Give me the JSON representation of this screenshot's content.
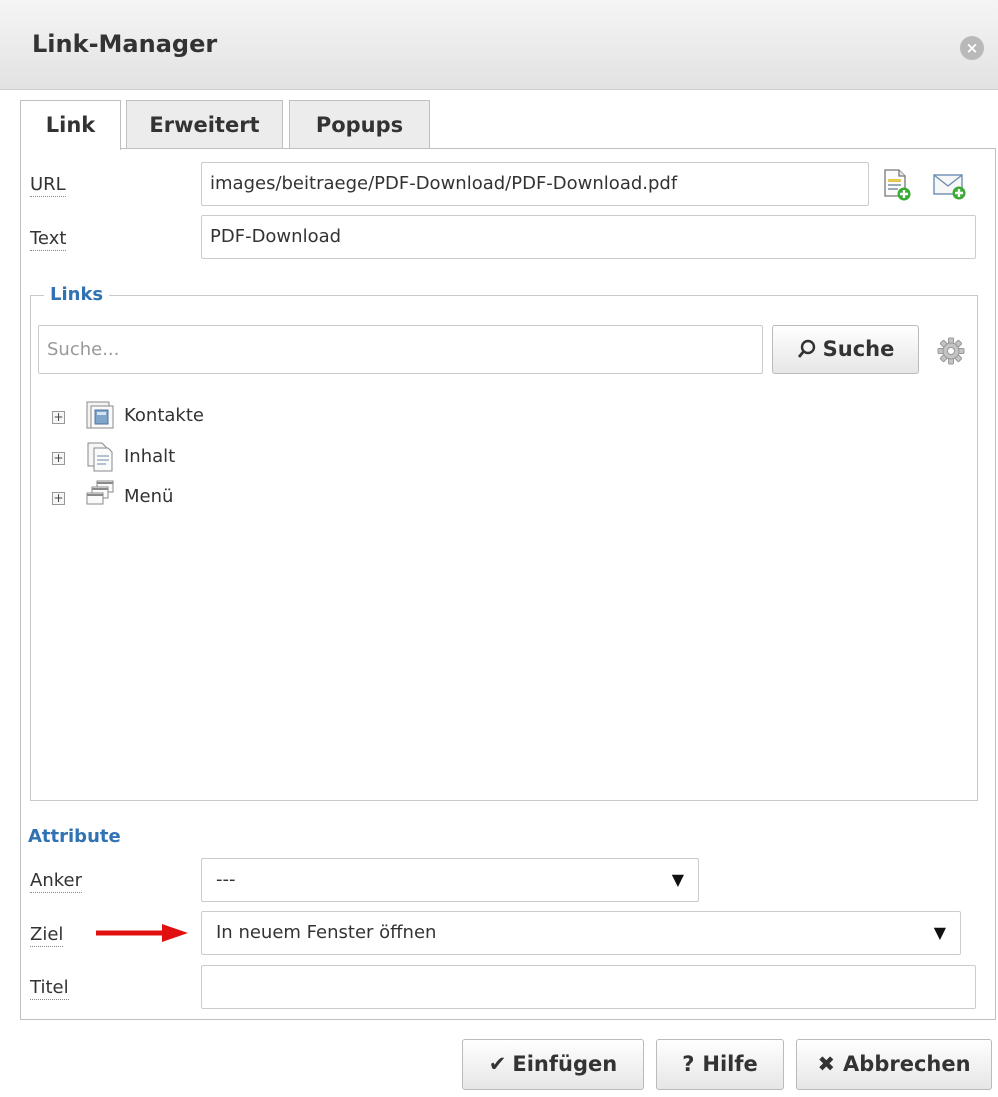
{
  "dialog": {
    "title": "Link-Manager",
    "close_icon": "close-icon"
  },
  "tabs": [
    {
      "label": "Link",
      "active": true
    },
    {
      "label": "Erweitert",
      "active": false
    },
    {
      "label": "Popups",
      "active": false
    }
  ],
  "link_tab": {
    "url_label": "URL",
    "url_value": "images/beitraege/PDF-Download/PDF-Download.pdf",
    "text_label": "Text",
    "text_value": "PDF-Download",
    "url_icons": [
      "file-add-icon",
      "email-add-icon"
    ]
  },
  "links_section": {
    "legend": "Links",
    "search_placeholder": "Suche...",
    "search_button": "Suche",
    "search_icon": "magnifier-icon",
    "settings_icon": "gear-icon",
    "tree": [
      {
        "label": "Kontakte",
        "icon": "contacts-icon"
      },
      {
        "label": "Inhalt",
        "icon": "articles-icon"
      },
      {
        "label": "Menü",
        "icon": "menu-icon"
      }
    ]
  },
  "attributes": {
    "section_title": "Attribute",
    "anchor_label": "Anker",
    "anchor_value": "---",
    "target_label": "Ziel",
    "target_value": "In neuem Fenster öffnen",
    "title_label": "Titel",
    "title_value": ""
  },
  "footer": {
    "insert_label": "Einfügen",
    "help_label": "Hilfe",
    "cancel_label": "Abbrechen"
  },
  "colors": {
    "accent": "#3072b2",
    "arrow": "#e01010"
  }
}
